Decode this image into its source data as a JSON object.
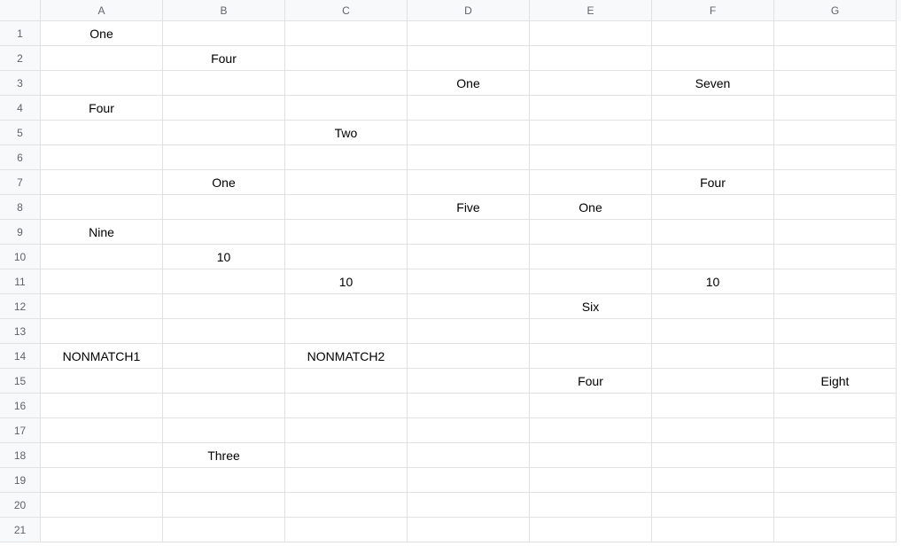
{
  "columns": [
    "A",
    "B",
    "C",
    "D",
    "E",
    "F",
    "G"
  ],
  "rows": [
    "1",
    "2",
    "3",
    "4",
    "5",
    "6",
    "7",
    "8",
    "9",
    "10",
    "11",
    "12",
    "13",
    "14",
    "15",
    "16",
    "17",
    "18",
    "19",
    "20",
    "21"
  ],
  "cells": {
    "A1": "One",
    "B2": "Four",
    "D3": "One",
    "F3": "Seven",
    "A4": "Four",
    "C5": "Two",
    "B7": "One",
    "F7": "Four",
    "D8": "Five",
    "E8": "One",
    "A9": "Nine",
    "B10": "10",
    "C11": "10",
    "F11": "10",
    "E12": "Six",
    "A14": "NONMATCH1",
    "C14": "NONMATCH2",
    "E15": "Four",
    "G15": "Eight",
    "B18": "Three"
  }
}
